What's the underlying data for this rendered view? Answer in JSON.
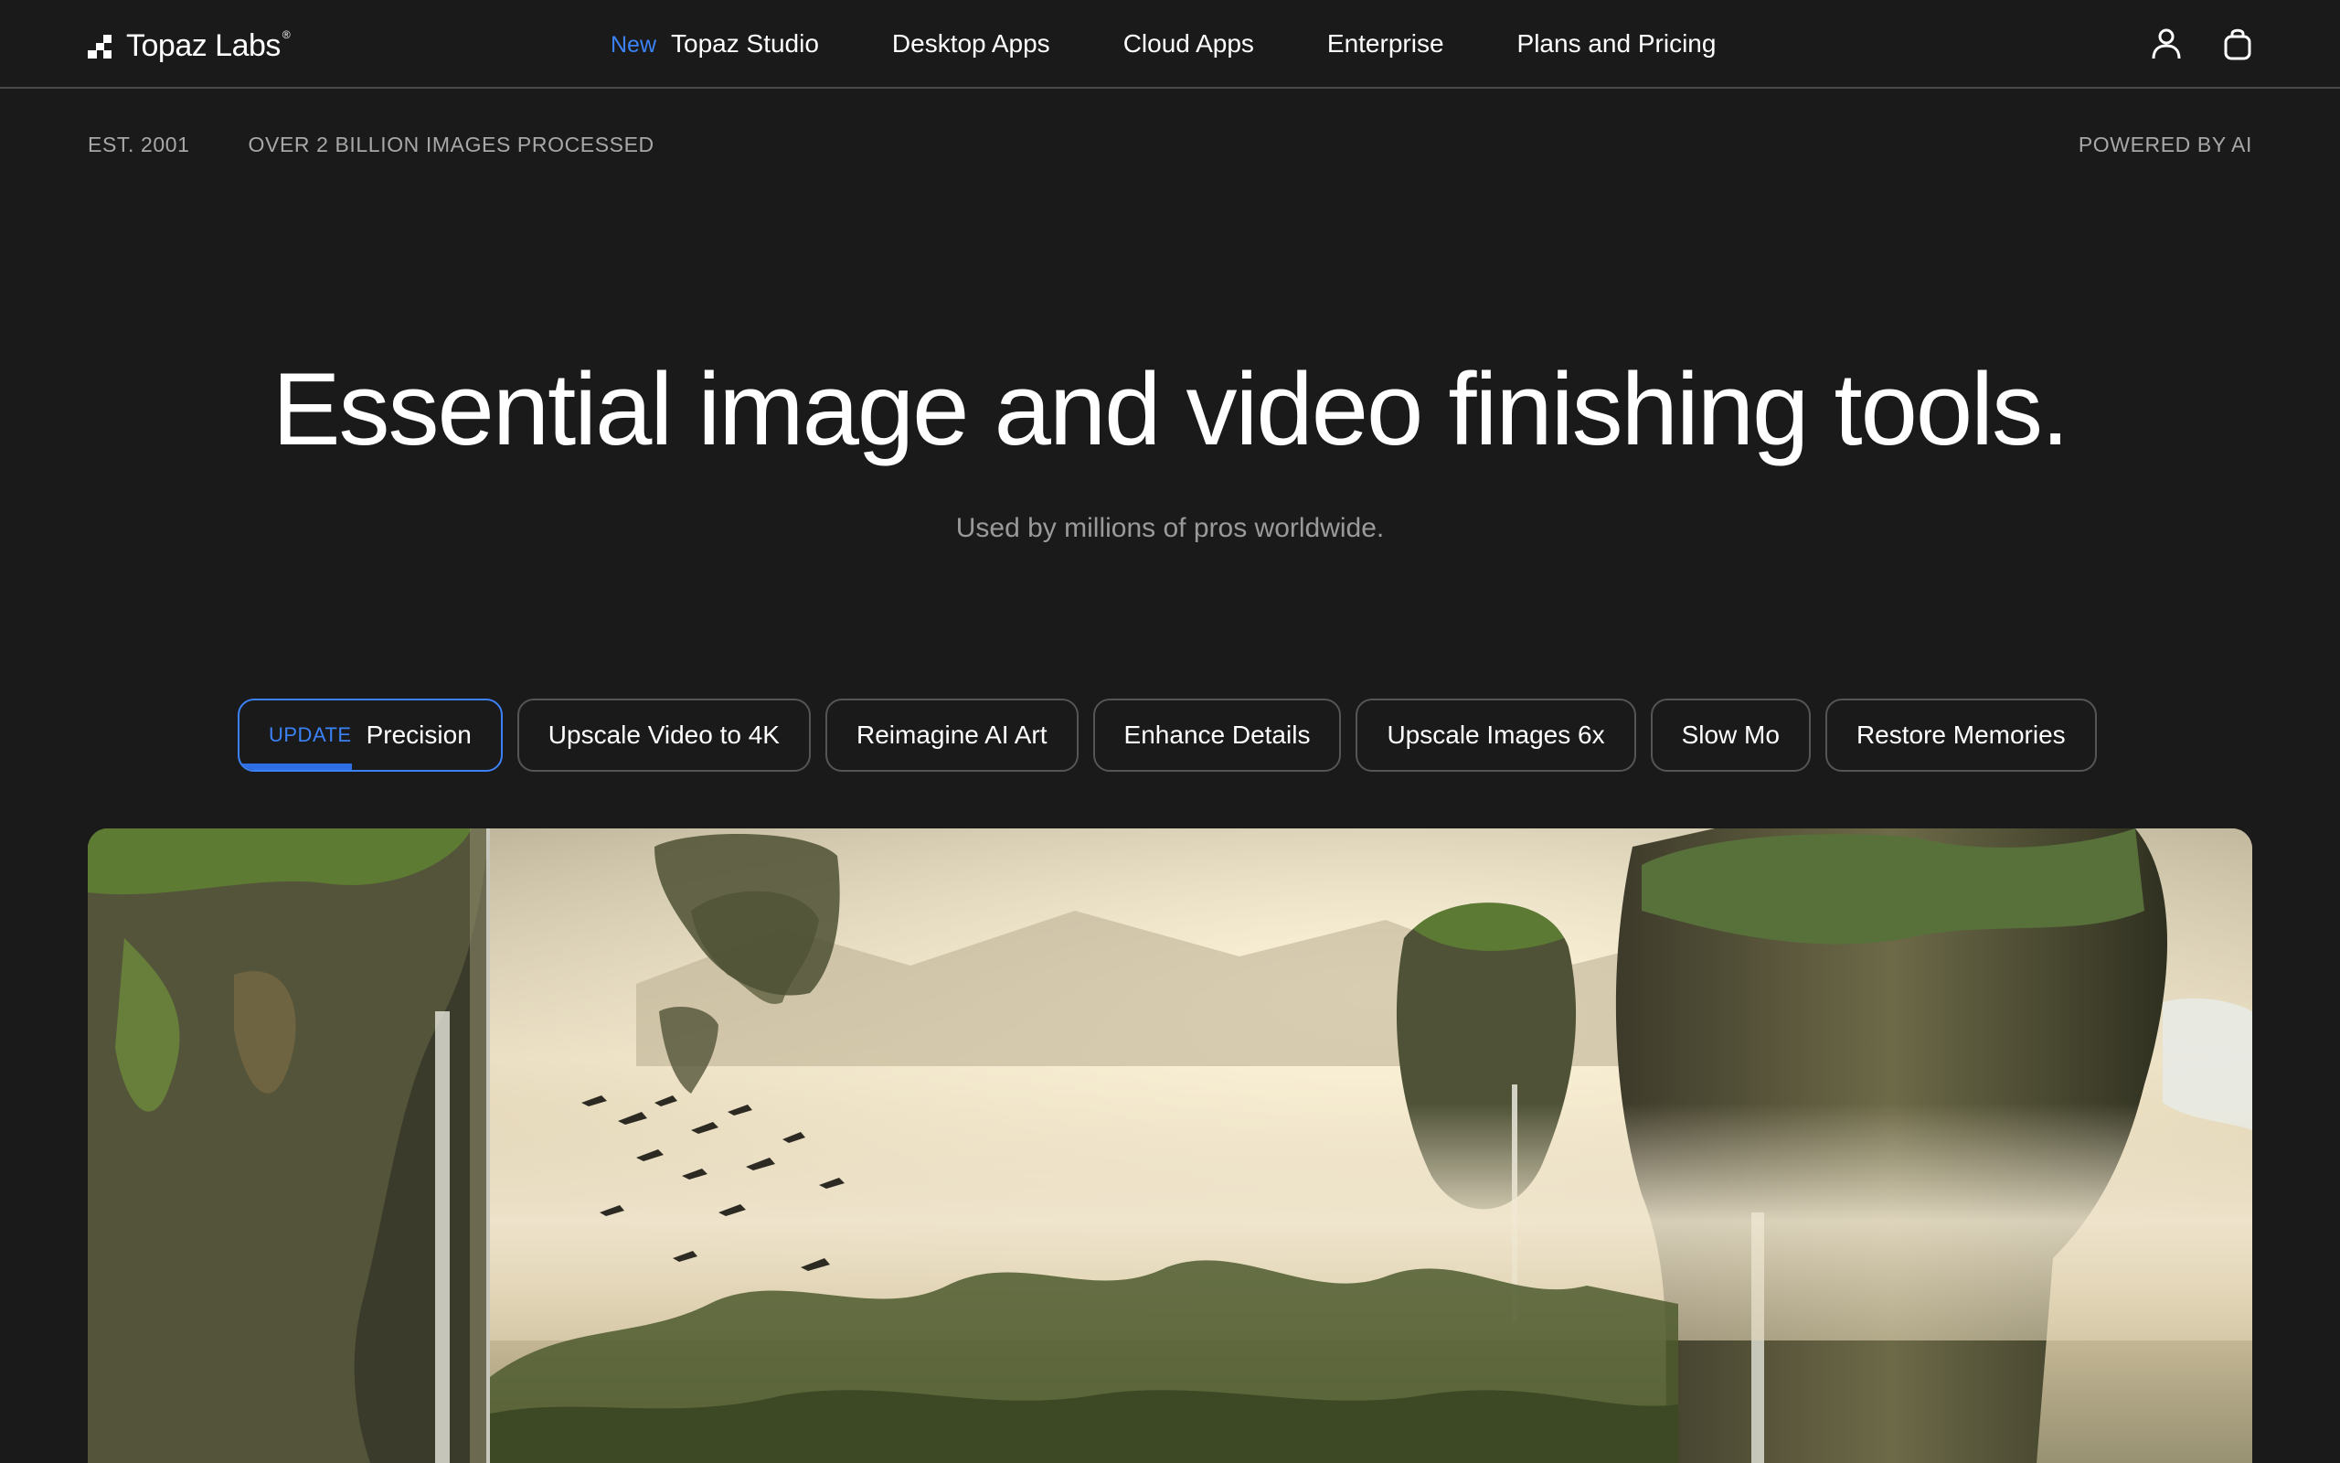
{
  "brand": {
    "name": "Topaz Labs",
    "trademark": "®"
  },
  "nav": {
    "new_badge": "New",
    "links": [
      {
        "label": "Topaz Studio"
      },
      {
        "label": "Desktop Apps"
      },
      {
        "label": "Cloud Apps"
      },
      {
        "label": "Enterprise"
      },
      {
        "label": "Plans and Pricing"
      }
    ],
    "icons": [
      "user-icon",
      "shopping-bag-icon"
    ]
  },
  "strip": {
    "established": "EST. 2001",
    "processed": "OVER 2 BILLION IMAGES PROCESSED",
    "powered": "POWERED BY AI"
  },
  "hero": {
    "title": "Essential image and video finishing tools.",
    "subtitle": "Used by millions of pros worldwide."
  },
  "tabs": {
    "active_badge": "UPDATE",
    "active_progress": 0.43,
    "items": [
      {
        "label": "Precision"
      },
      {
        "label": "Upscale Video to 4K"
      },
      {
        "label": "Reimagine AI Art"
      },
      {
        "label": "Enhance Details"
      },
      {
        "label": "Upscale Images 6x"
      },
      {
        "label": "Slow Mo"
      },
      {
        "label": "Restore Memories"
      }
    ]
  },
  "colors": {
    "background": "#1a1a1a",
    "accent": "#3b82f6",
    "text": "#ffffff",
    "muted": "#a8a8a8"
  }
}
